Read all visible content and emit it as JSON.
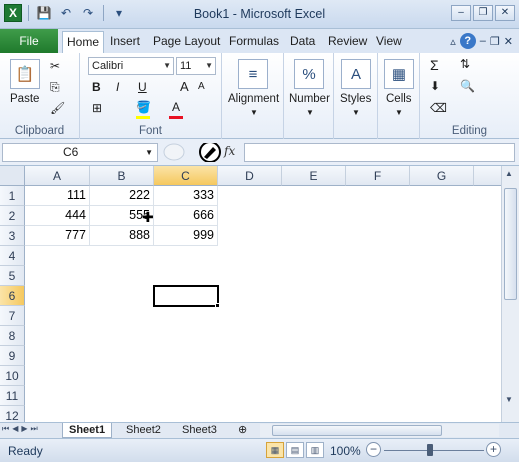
{
  "window": {
    "title": "Book1 - Microsoft Excel"
  },
  "qat": {
    "app_icon": "X",
    "save": "💾",
    "undo": "↶",
    "redo": "↷",
    "customize": "▾"
  },
  "tabs": {
    "file": "File",
    "items": [
      "Home",
      "Insert",
      "Page Layout",
      "Formulas",
      "Data",
      "Review",
      "View"
    ],
    "active": "Home"
  },
  "ribbon": {
    "clipboard": {
      "label": "Clipboard",
      "paste": "Paste"
    },
    "font": {
      "label": "Font",
      "name": "Calibri",
      "size": "11",
      "bold": "B",
      "italic": "I",
      "underline": "U",
      "grow": "A",
      "shrink": "A",
      "color_letter": "A"
    },
    "alignment": {
      "label": "Alignment"
    },
    "number": {
      "label": "Number",
      "icon": "%"
    },
    "styles": {
      "label": "Styles"
    },
    "cells": {
      "label": "Cells"
    },
    "editing": {
      "label": "Editing",
      "sigma": "Σ"
    }
  },
  "formula_bar": {
    "name_box": "C6",
    "fx": "fx",
    "formula": ""
  },
  "grid": {
    "columns": [
      "A",
      "B",
      "C",
      "D",
      "E",
      "F",
      "G"
    ],
    "rows": [
      "1",
      "2",
      "3",
      "4",
      "5",
      "6",
      "7",
      "8",
      "9",
      "10",
      "11",
      "12"
    ],
    "selected_column": "C",
    "selected_row": "6",
    "cells": [
      [
        "111",
        "222",
        "333"
      ],
      [
        "444",
        "555",
        "666"
      ],
      [
        "777",
        "888",
        "999"
      ]
    ]
  },
  "sheets": {
    "tabs": [
      "Sheet1",
      "Sheet2",
      "Sheet3"
    ],
    "active": "Sheet1"
  },
  "status": {
    "text": "Ready",
    "zoom": "100%",
    "zoom_out": "−",
    "zoom_in": "+"
  }
}
